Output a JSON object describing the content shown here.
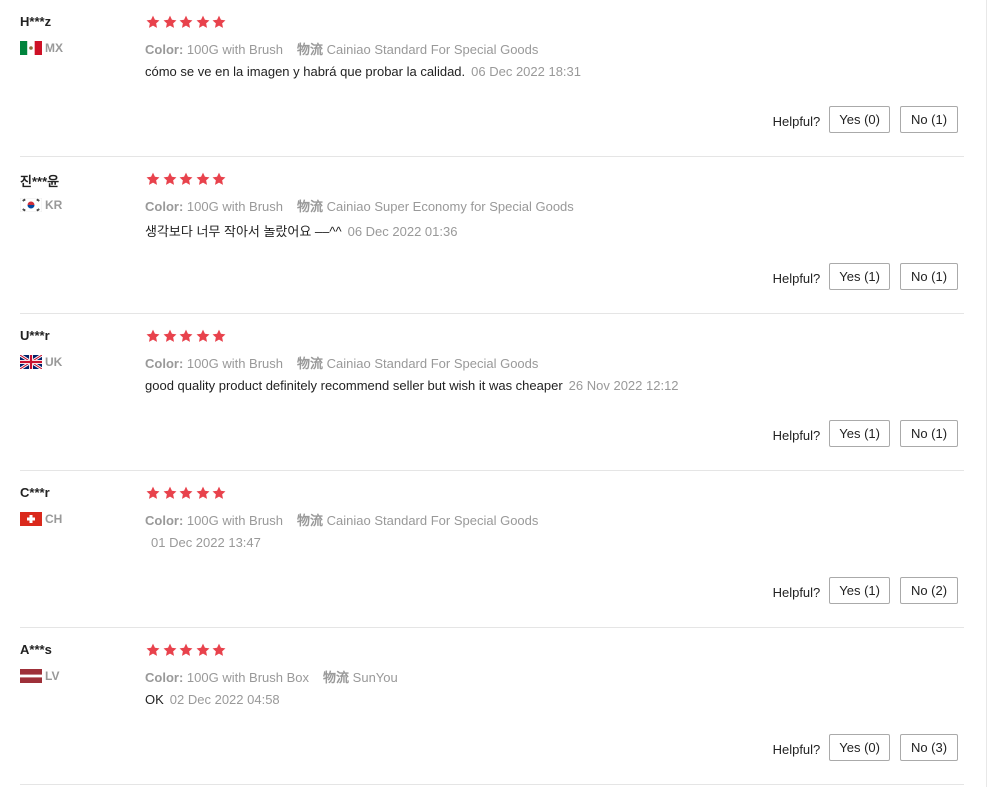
{
  "colors": {
    "star": "#e8424c",
    "muted": "#999999",
    "divider": "#e5e5e5"
  },
  "reviews": [
    {
      "user": "H***z",
      "country": "MX",
      "flag": "mexico-flag-icon",
      "stars": 5,
      "color_label": "Color:",
      "color_value": "100G with Brush",
      "logistics_label": "物流",
      "logistics_value": "Cainiao Standard For Special Goods",
      "text": "cómo se ve en la imagen y habrá que probar la calidad.",
      "date": "06 Dec 2022 18:31",
      "helpful_label": "Helpful?",
      "yes_label": "Yes (0)",
      "no_label": "No (1)"
    },
    {
      "user": "진***윤",
      "country": "KR",
      "flag": "korea-flag-icon",
      "stars": 5,
      "color_label": "Color:",
      "color_value": "100G with Brush",
      "logistics_label": "物流",
      "logistics_value": "Cainiao Super Economy for Special Goods",
      "text": "생각보다 너무 작아서 놀랐어요 ––^^",
      "date": "06 Dec 2022 01:36",
      "helpful_label": "Helpful?",
      "yes_label": "Yes (1)",
      "no_label": "No (1)"
    },
    {
      "user": "U***r",
      "country": "UK",
      "flag": "uk-flag-icon",
      "stars": 5,
      "color_label": "Color:",
      "color_value": "100G with Brush",
      "logistics_label": "物流",
      "logistics_value": "Cainiao Standard For Special Goods",
      "text": "good quality product definitely recommend seller but wish it was cheaper",
      "date": "26 Nov 2022 12:12",
      "helpful_label": "Helpful?",
      "yes_label": "Yes (1)",
      "no_label": "No (1)"
    },
    {
      "user": "C***r",
      "country": "CH",
      "flag": "switzerland-flag-icon",
      "stars": 5,
      "color_label": "Color:",
      "color_value": "100G with Brush",
      "logistics_label": "物流",
      "logistics_value": "Cainiao Standard For Special Goods",
      "text": "",
      "date": "01 Dec 2022 13:47",
      "helpful_label": "Helpful?",
      "yes_label": "Yes (1)",
      "no_label": "No (2)"
    },
    {
      "user": "A***s",
      "country": "LV",
      "flag": "latvia-flag-icon",
      "stars": 5,
      "color_label": "Color:",
      "color_value": "100G with Brush Box",
      "logistics_label": "物流",
      "logistics_value": "SunYou",
      "text": "OK",
      "date": "02 Dec 2022 04:58",
      "helpful_label": "Helpful?",
      "yes_label": "Yes (0)",
      "no_label": "No (3)"
    }
  ]
}
